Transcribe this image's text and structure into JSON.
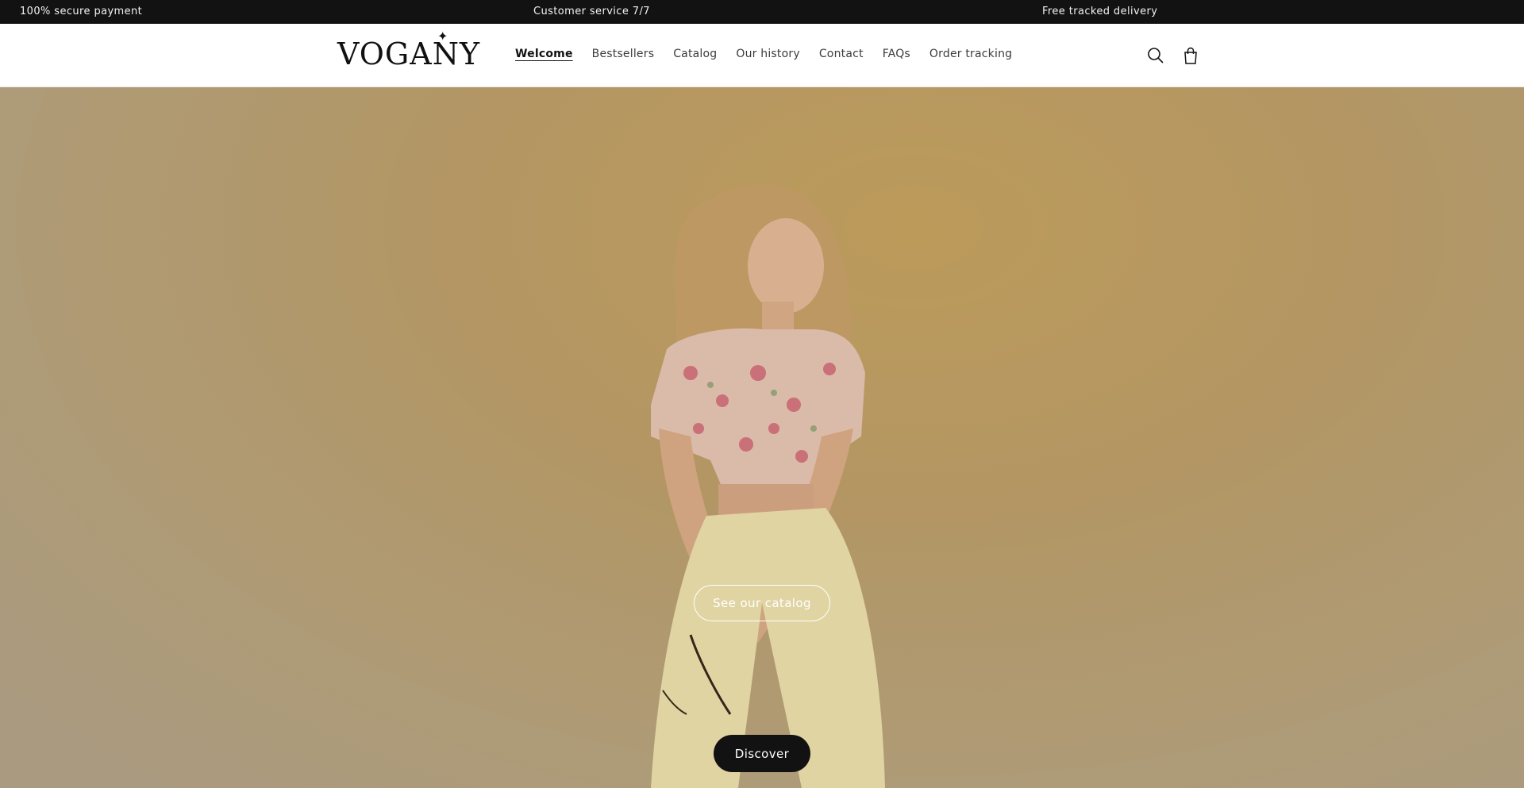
{
  "announcement": {
    "left": "100% secure payment",
    "center": "Customer service 7/7",
    "right": "Free tracked delivery"
  },
  "header": {
    "logo": "VOGANY",
    "nav": [
      {
        "label": "Welcome",
        "active": true
      },
      {
        "label": "Bestsellers",
        "active": false
      },
      {
        "label": "Catalog",
        "active": false
      },
      {
        "label": "Our history",
        "active": false
      },
      {
        "label": "Contact",
        "active": false
      },
      {
        "label": "FAQs",
        "active": false
      },
      {
        "label": "Order tracking",
        "active": false
      }
    ],
    "icons": [
      "search-icon",
      "bag-icon"
    ]
  },
  "hero": {
    "primary_button": "See our catalog",
    "secondary_button": "Discover"
  },
  "colors": {
    "announcement_bg": "#121212",
    "hero_bg": "#c3a46a",
    "button_dark": "#121212"
  }
}
